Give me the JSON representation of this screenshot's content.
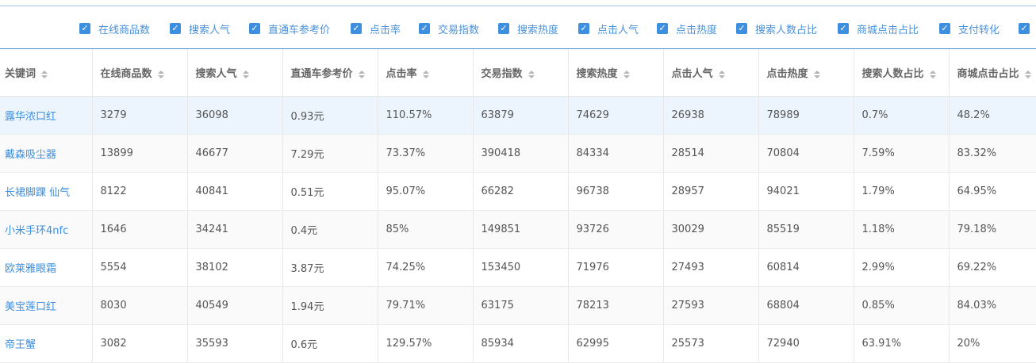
{
  "filters": [
    {
      "label": "在线商品数",
      "checked": true
    },
    {
      "label": "搜索人气",
      "checked": true
    },
    {
      "label": "直通车参考价",
      "checked": true
    },
    {
      "label": "点击率",
      "checked": true
    },
    {
      "label": "交易指数",
      "checked": true
    },
    {
      "label": "搜索热度",
      "checked": true
    },
    {
      "label": "点击人气",
      "checked": true
    },
    {
      "label": "点击热度",
      "checked": true
    },
    {
      "label": "搜索人数占比",
      "checked": true
    },
    {
      "label": "商城点击占比",
      "checked": true
    },
    {
      "label": "支付转化",
      "checked": true
    },
    {
      "label": "",
      "checked": true
    }
  ],
  "table": {
    "headers": [
      "关键词",
      "在线商品数",
      "搜索人气",
      "直通车参考价",
      "点击率",
      "交易指数",
      "搜索热度",
      "点击人气",
      "点击热度",
      "搜索人数占比",
      "商城点击占比"
    ],
    "rows": [
      [
        "露华浓口红",
        "3279",
        "36098",
        "0.93元",
        "110.57%",
        "63879",
        "74629",
        "26938",
        "78989",
        "0.7%",
        "48.2%"
      ],
      [
        "戴森吸尘器",
        "13899",
        "46677",
        "7.29元",
        "73.37%",
        "390418",
        "84334",
        "28514",
        "70804",
        "7.59%",
        "83.32%"
      ],
      [
        "长裙脚踝 仙气",
        "8122",
        "40841",
        "0.51元",
        "95.07%",
        "66282",
        "96738",
        "28957",
        "94021",
        "1.79%",
        "64.95%"
      ],
      [
        "小米手环4nfc",
        "1646",
        "34241",
        "0.4元",
        "85%",
        "149851",
        "93726",
        "30029",
        "85519",
        "1.18%",
        "79.18%"
      ],
      [
        "欧莱雅眼霜",
        "5554",
        "38102",
        "3.87元",
        "74.25%",
        "153450",
        "71976",
        "27493",
        "60814",
        "2.99%",
        "69.22%"
      ],
      [
        "美宝莲口红",
        "8030",
        "40549",
        "1.94元",
        "79.71%",
        "63175",
        "78213",
        "27593",
        "68804",
        "0.85%",
        "84.03%"
      ],
      [
        "帝王蟹",
        "3082",
        "35593",
        "0.6元",
        "129.57%",
        "85934",
        "62995",
        "25573",
        "72940",
        "63.91%",
        "20%"
      ]
    ]
  },
  "colors": {
    "accent": "#3d8fe0",
    "highlight_row": "#ecf5fe"
  }
}
